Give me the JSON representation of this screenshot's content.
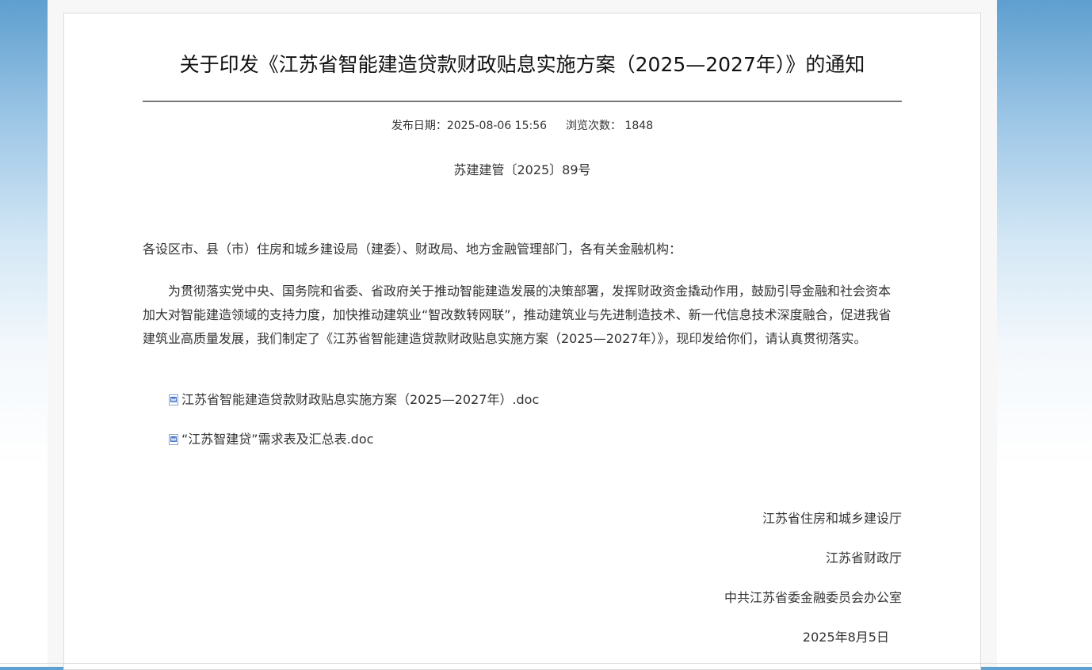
{
  "article": {
    "title": "关于印发《江苏省智能建造贷款财政贴息实施方案（2025—2027年）》的通知",
    "publish_label": "发布日期：",
    "publish_date": "2025-08-06 15:56",
    "views_label": "浏览次数：",
    "views_count": "1848",
    "doc_number": "苏建建管〔2025〕89号",
    "salutation": "各设区市、县（市）住房和城乡建设局（建委）、财政局、地方金融管理部门，各有关金融机构：",
    "body": "为贯彻落实党中央、国务院和省委、省政府关于推动智能建造发展的决策部署，发挥财政资金撬动作用，鼓励引导金融和社会资本加大对智能建造领域的支持力度，加快推动建筑业“智改数转网联”，推动建筑业与先进制造技术、新一代信息技术深度融合，促进我省建筑业高质量发展，我们制定了《江苏省智能建造贷款财政贴息实施方案（2025—2027年）》，现印发给你们，请认真贯彻落实。",
    "attachments": [
      {
        "label": "江苏省智能建造贷款财政贴息实施方案（2025—2027年）.doc",
        "icon": "word-doc-icon"
      },
      {
        "label": "“江苏智建贷”需求表及汇总表.doc",
        "icon": "word-doc-icon"
      }
    ],
    "signatures": [
      "江苏省住房和城乡建设厅",
      "江苏省财政厅",
      "中共江苏省委金融委员会办公室",
      "2025年8月5日"
    ]
  },
  "colors": {
    "background_top": "#5e9fcf",
    "text": "#333333",
    "title": "#111111",
    "rule": "#777777"
  }
}
